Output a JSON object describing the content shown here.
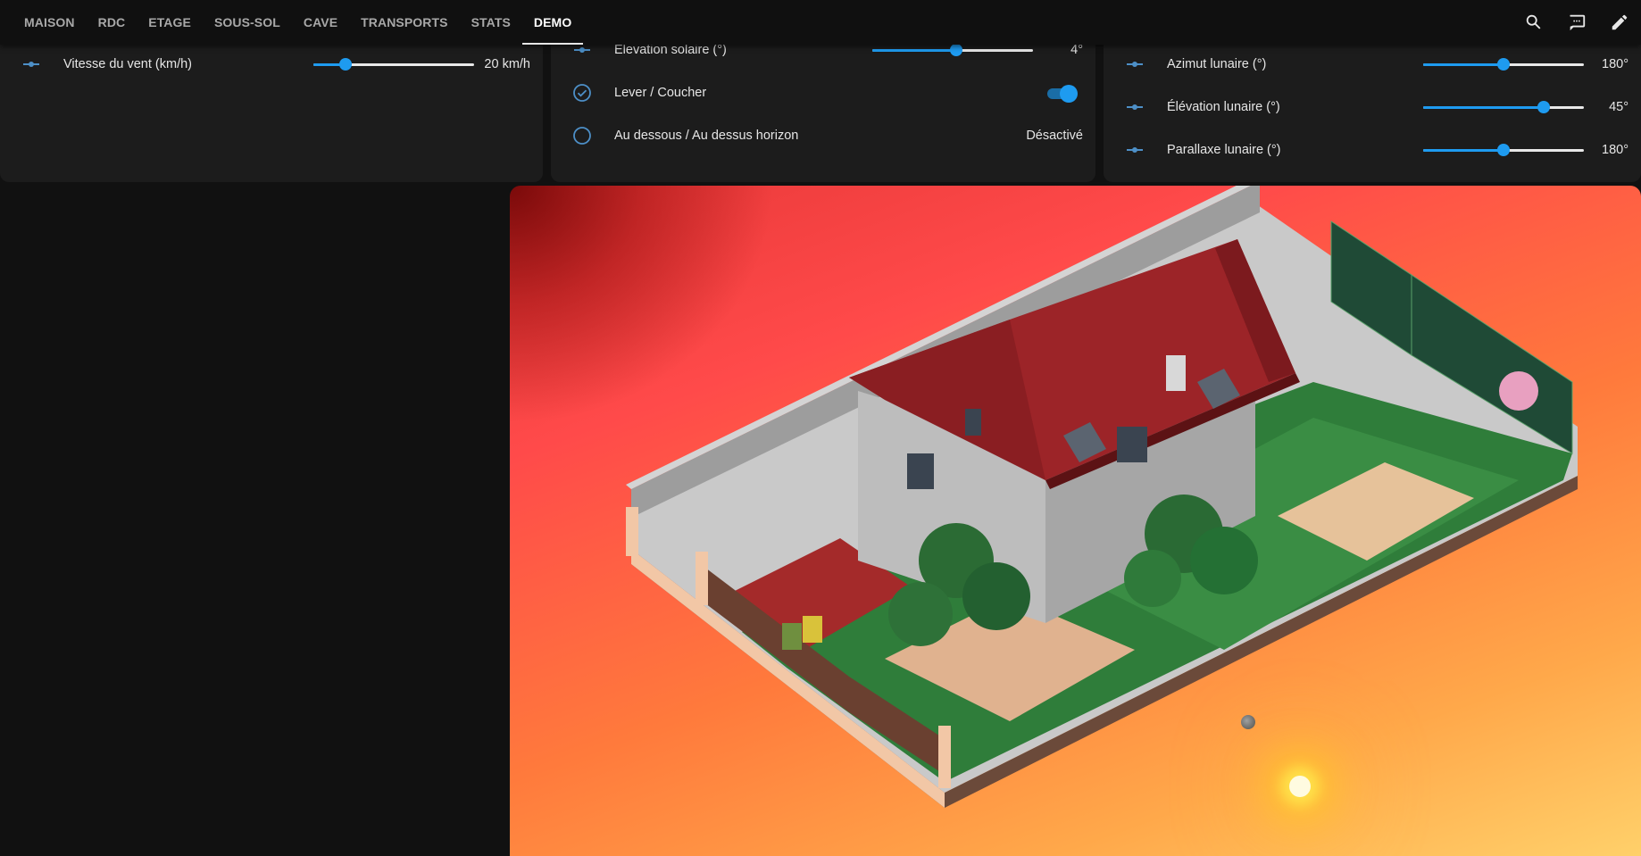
{
  "tabs": [
    {
      "label": "MAISON"
    },
    {
      "label": "RDC"
    },
    {
      "label": "ETAGE"
    },
    {
      "label": "SOUS-SOL"
    },
    {
      "label": "CAVE"
    },
    {
      "label": "TRANSPORTS"
    },
    {
      "label": "STATS"
    },
    {
      "label": "DEMO"
    }
  ],
  "active_tab": "DEMO",
  "actions": {
    "search": "search-icon",
    "assist": "chat-icon",
    "edit": "pencil-icon"
  },
  "weather_card": {
    "wind": {
      "label": "Vitesse du vent (km/h)",
      "value": "20 km/h",
      "level": 0.2
    }
  },
  "sun_card": {
    "elevation": {
      "label": "Élevation solaire (°)",
      "value": "4°",
      "level": 0.52
    },
    "rise_set": {
      "label": "Lever / Coucher",
      "state": "on"
    },
    "horizon": {
      "label": "Au dessous / Au dessus horizon",
      "value": "Désactivé"
    }
  },
  "moon_card": {
    "azimuth": {
      "label": "Azimut lunaire (°)",
      "value": "180°",
      "level": 0.5
    },
    "elevation": {
      "label": "Élévation lunaire (°)",
      "value": "45°",
      "level": 0.75
    },
    "parallax": {
      "label": "Parallaxe lunaire (°)",
      "value": "180°",
      "level": 0.5
    }
  },
  "colors": {
    "accent": "#1e9bf0",
    "background": "#111111",
    "card": "#1c1c1c",
    "roof": "#a8262a",
    "sky_top": "#7a0a0a",
    "sky_bottom": "#ffd06a"
  }
}
